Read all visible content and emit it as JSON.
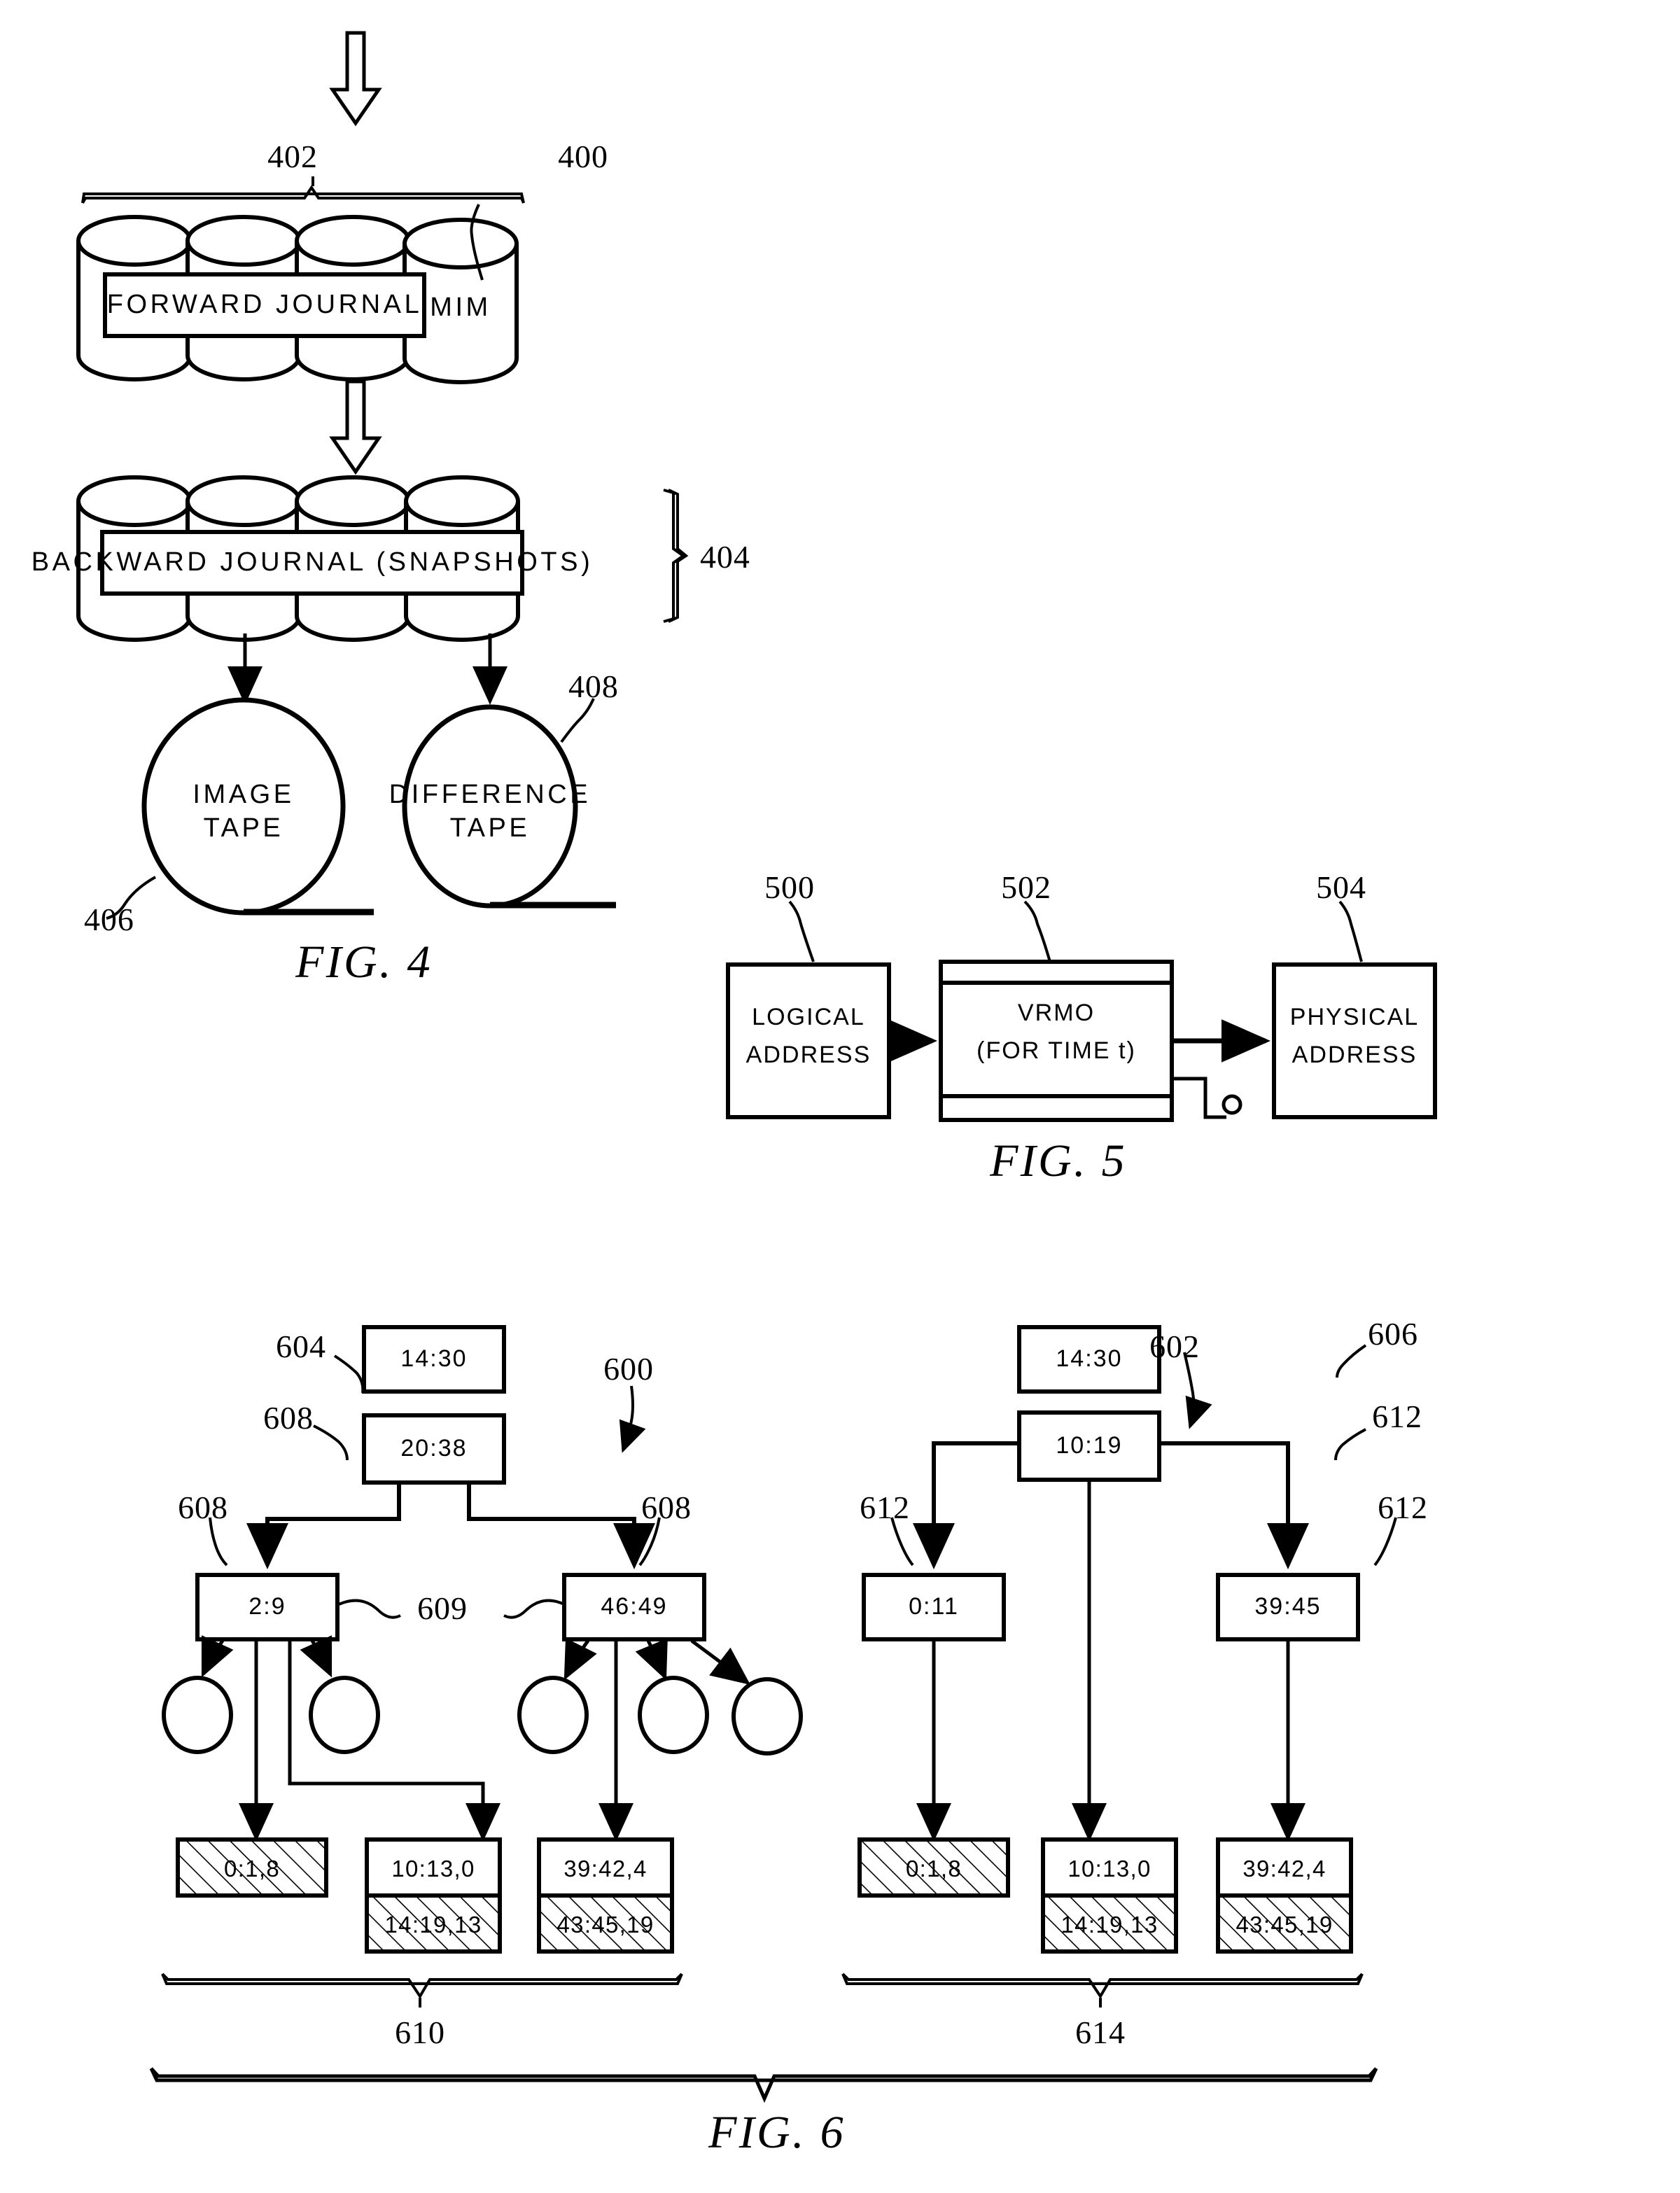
{
  "figures": [
    {
      "id": "fig4",
      "caption": "FIG.  4",
      "refs": {
        "mim": "400",
        "forward_journal_group": "402",
        "backward_journal_group": "404",
        "image_tape": "406",
        "difference_tape": "408"
      },
      "labels": {
        "forward_journal": "FORWARD  JOURNAL",
        "mim": "MIM",
        "backward_journal": "BACKWARD  JOURNAL  (SNAPSHOTS)",
        "image_tape_line1": "IMAGE",
        "image_tape_line2": "TAPE",
        "difference_tape_line1": "DIFFERENCE",
        "difference_tape_line2": "TAPE"
      }
    },
    {
      "id": "fig5",
      "caption": "FIG.  5",
      "refs": {
        "logical_address": "500",
        "vrmo": "502",
        "physical_address": "504"
      },
      "blocks": [
        {
          "name": "logical-address",
          "line1": "LOGICAL",
          "line2": "ADDRESS"
        },
        {
          "name": "vrmo",
          "line1": "VRMO",
          "line2": "(FOR TIME t)"
        },
        {
          "name": "physical-address",
          "line1": "PHYSICAL",
          "line2": "ADDRESS"
        }
      ]
    },
    {
      "id": "fig6",
      "caption": "FIG.  6",
      "refs": {
        "left_tree": "600",
        "right_tree": "602",
        "left_root": "604",
        "right_root": "606",
        "left_nodes": "608",
        "left_sibling_link": "609",
        "left_leaf_group": "610",
        "right_nodes": "612",
        "right_leaf_group": "614"
      },
      "left_tree": {
        "root_detached": "14:30",
        "root": "20:38",
        "children": [
          "2:9",
          "46:49"
        ],
        "leaf_cells": [
          {
            "top": "0:1,8",
            "top_hatched": true,
            "bottom": null
          },
          {
            "top": "10:13,0",
            "top_hatched": false,
            "bottom": "14:19,13"
          },
          {
            "top": "39:42,4",
            "top_hatched": false,
            "bottom": "43:45,19"
          }
        ]
      },
      "right_tree": {
        "root_detached": "14:30",
        "root": "10:19",
        "children": [
          "0:11",
          "39:45"
        ],
        "leaf_cells": [
          {
            "top": "0:1,8",
            "top_hatched": true,
            "bottom": null
          },
          {
            "top": "10:13,0",
            "top_hatched": false,
            "bottom": "14:19,13"
          },
          {
            "top": "39:42,4",
            "top_hatched": false,
            "bottom": "43:45,19"
          }
        ]
      }
    }
  ]
}
